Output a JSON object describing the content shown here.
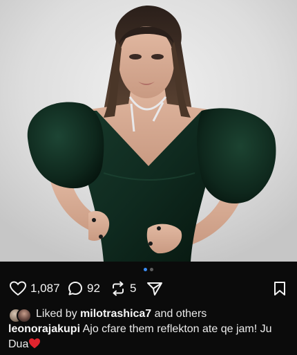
{
  "post": {
    "image_alt_icon": "portrait-photo",
    "carousel": {
      "count": 2,
      "active": 1
    },
    "actions": {
      "likes": "1,087",
      "comments": "92",
      "reposts": "5"
    },
    "liked_by": {
      "prefix": "Liked by",
      "user": "milotrashica7",
      "suffix": "and others"
    },
    "caption": {
      "username": "leonorajakupi",
      "text": "Ajo cfare them reflekton ate qe jam! Ju Dua",
      "emoji": "red-heart-emoji"
    }
  },
  "colors": {
    "background": "#0b0b0b",
    "text": "#f2f2f2",
    "carousel_active": "#3b8df4",
    "dress": "#0f2a1f",
    "heart_emoji": "#e0242e"
  }
}
